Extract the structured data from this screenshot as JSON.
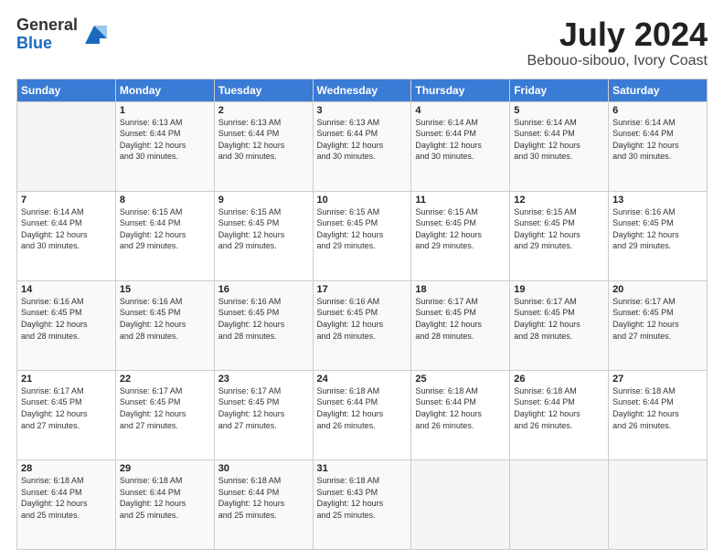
{
  "logo": {
    "general": "General",
    "blue": "Blue"
  },
  "title": "July 2024",
  "subtitle": "Bebouo-sibouo, Ivory Coast",
  "days_header": [
    "Sunday",
    "Monday",
    "Tuesday",
    "Wednesday",
    "Thursday",
    "Friday",
    "Saturday"
  ],
  "weeks": [
    [
      {
        "day": "",
        "info": ""
      },
      {
        "day": "1",
        "info": "Sunrise: 6:13 AM\nSunset: 6:44 PM\nDaylight: 12 hours\nand 30 minutes."
      },
      {
        "day": "2",
        "info": "Sunrise: 6:13 AM\nSunset: 6:44 PM\nDaylight: 12 hours\nand 30 minutes."
      },
      {
        "day": "3",
        "info": "Sunrise: 6:13 AM\nSunset: 6:44 PM\nDaylight: 12 hours\nand 30 minutes."
      },
      {
        "day": "4",
        "info": "Sunrise: 6:14 AM\nSunset: 6:44 PM\nDaylight: 12 hours\nand 30 minutes."
      },
      {
        "day": "5",
        "info": "Sunrise: 6:14 AM\nSunset: 6:44 PM\nDaylight: 12 hours\nand 30 minutes."
      },
      {
        "day": "6",
        "info": "Sunrise: 6:14 AM\nSunset: 6:44 PM\nDaylight: 12 hours\nand 30 minutes."
      }
    ],
    [
      {
        "day": "7",
        "info": "Sunrise: 6:14 AM\nSunset: 6:44 PM\nDaylight: 12 hours\nand 30 minutes."
      },
      {
        "day": "8",
        "info": "Sunrise: 6:15 AM\nSunset: 6:44 PM\nDaylight: 12 hours\nand 29 minutes."
      },
      {
        "day": "9",
        "info": "Sunrise: 6:15 AM\nSunset: 6:45 PM\nDaylight: 12 hours\nand 29 minutes."
      },
      {
        "day": "10",
        "info": "Sunrise: 6:15 AM\nSunset: 6:45 PM\nDaylight: 12 hours\nand 29 minutes."
      },
      {
        "day": "11",
        "info": "Sunrise: 6:15 AM\nSunset: 6:45 PM\nDaylight: 12 hours\nand 29 minutes."
      },
      {
        "day": "12",
        "info": "Sunrise: 6:15 AM\nSunset: 6:45 PM\nDaylight: 12 hours\nand 29 minutes."
      },
      {
        "day": "13",
        "info": "Sunrise: 6:16 AM\nSunset: 6:45 PM\nDaylight: 12 hours\nand 29 minutes."
      }
    ],
    [
      {
        "day": "14",
        "info": "Sunrise: 6:16 AM\nSunset: 6:45 PM\nDaylight: 12 hours\nand 28 minutes."
      },
      {
        "day": "15",
        "info": "Sunrise: 6:16 AM\nSunset: 6:45 PM\nDaylight: 12 hours\nand 28 minutes."
      },
      {
        "day": "16",
        "info": "Sunrise: 6:16 AM\nSunset: 6:45 PM\nDaylight: 12 hours\nand 28 minutes."
      },
      {
        "day": "17",
        "info": "Sunrise: 6:16 AM\nSunset: 6:45 PM\nDaylight: 12 hours\nand 28 minutes."
      },
      {
        "day": "18",
        "info": "Sunrise: 6:17 AM\nSunset: 6:45 PM\nDaylight: 12 hours\nand 28 minutes."
      },
      {
        "day": "19",
        "info": "Sunrise: 6:17 AM\nSunset: 6:45 PM\nDaylight: 12 hours\nand 28 minutes."
      },
      {
        "day": "20",
        "info": "Sunrise: 6:17 AM\nSunset: 6:45 PM\nDaylight: 12 hours\nand 27 minutes."
      }
    ],
    [
      {
        "day": "21",
        "info": "Sunrise: 6:17 AM\nSunset: 6:45 PM\nDaylight: 12 hours\nand 27 minutes."
      },
      {
        "day": "22",
        "info": "Sunrise: 6:17 AM\nSunset: 6:45 PM\nDaylight: 12 hours\nand 27 minutes."
      },
      {
        "day": "23",
        "info": "Sunrise: 6:17 AM\nSunset: 6:45 PM\nDaylight: 12 hours\nand 27 minutes."
      },
      {
        "day": "24",
        "info": "Sunrise: 6:18 AM\nSunset: 6:44 PM\nDaylight: 12 hours\nand 26 minutes."
      },
      {
        "day": "25",
        "info": "Sunrise: 6:18 AM\nSunset: 6:44 PM\nDaylight: 12 hours\nand 26 minutes."
      },
      {
        "day": "26",
        "info": "Sunrise: 6:18 AM\nSunset: 6:44 PM\nDaylight: 12 hours\nand 26 minutes."
      },
      {
        "day": "27",
        "info": "Sunrise: 6:18 AM\nSunset: 6:44 PM\nDaylight: 12 hours\nand 26 minutes."
      }
    ],
    [
      {
        "day": "28",
        "info": "Sunrise: 6:18 AM\nSunset: 6:44 PM\nDaylight: 12 hours\nand 25 minutes."
      },
      {
        "day": "29",
        "info": "Sunrise: 6:18 AM\nSunset: 6:44 PM\nDaylight: 12 hours\nand 25 minutes."
      },
      {
        "day": "30",
        "info": "Sunrise: 6:18 AM\nSunset: 6:44 PM\nDaylight: 12 hours\nand 25 minutes."
      },
      {
        "day": "31",
        "info": "Sunrise: 6:18 AM\nSunset: 6:43 PM\nDaylight: 12 hours\nand 25 minutes."
      },
      {
        "day": "",
        "info": ""
      },
      {
        "day": "",
        "info": ""
      },
      {
        "day": "",
        "info": ""
      }
    ]
  ]
}
